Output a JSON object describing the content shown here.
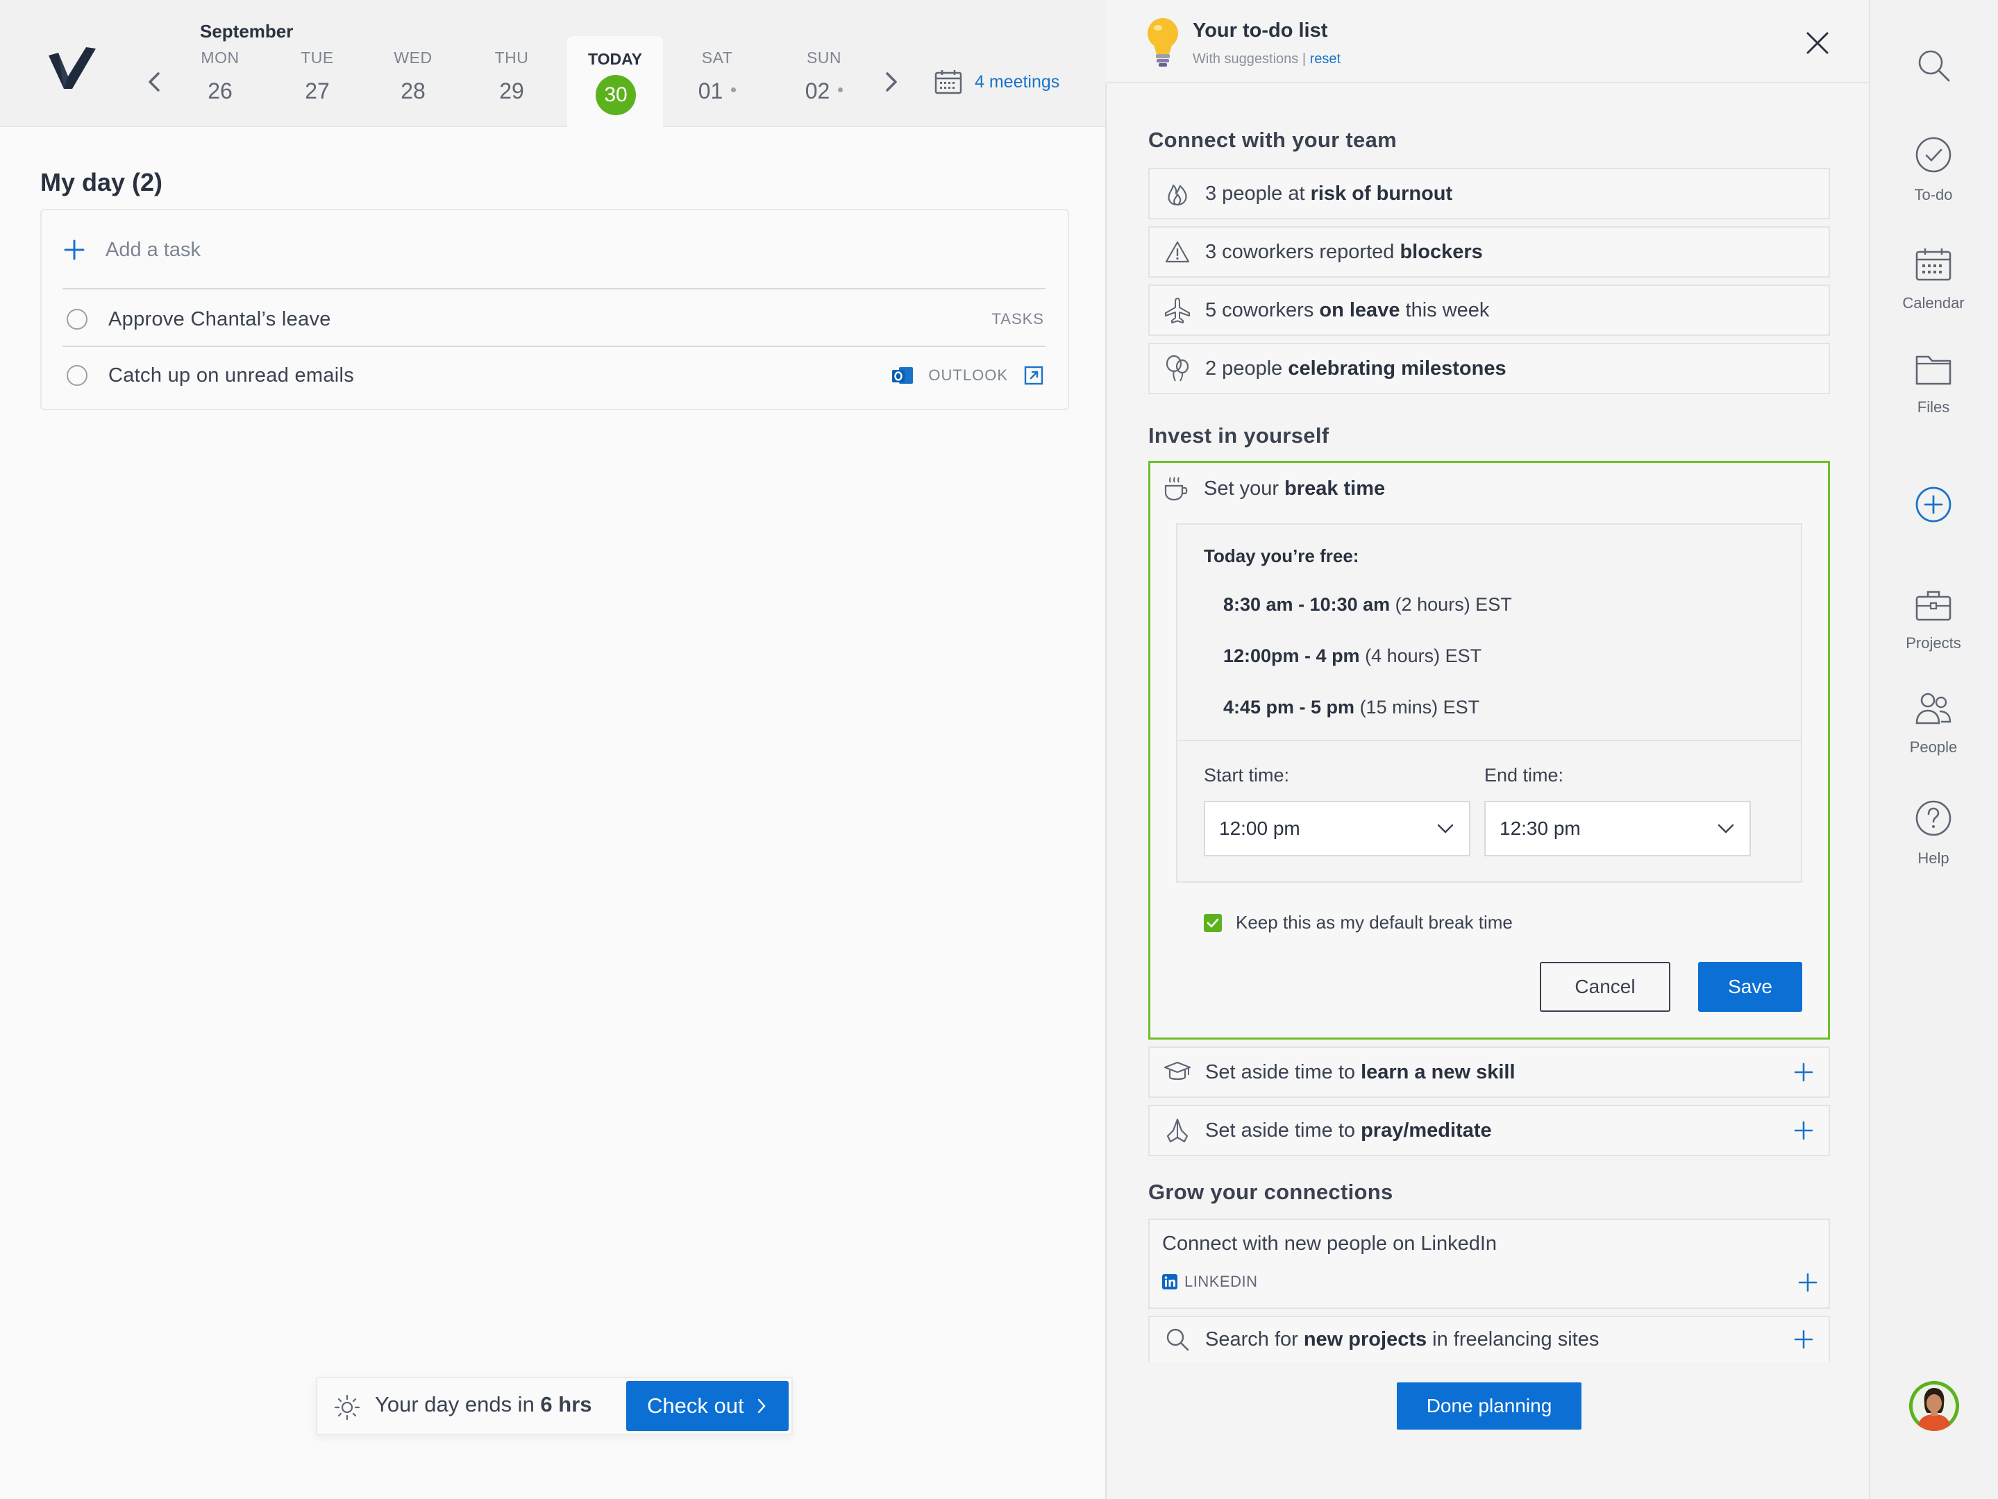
{
  "calendar": {
    "month": "September",
    "days": [
      {
        "name": "MON",
        "num": "26"
      },
      {
        "name": "TUE",
        "num": "27"
      },
      {
        "name": "WED",
        "num": "28"
      },
      {
        "name": "THU",
        "num": "29"
      },
      {
        "name": "TODAY",
        "num": "30"
      },
      {
        "name": "SAT",
        "num": "01"
      },
      {
        "name": "SUN",
        "num": "02"
      }
    ],
    "meetings": "4 meetings"
  },
  "myday": {
    "title": "My day (2)",
    "add_task": "Add a task",
    "tasks": [
      {
        "text": "Approve Chantal’s leave",
        "source": "TASKS"
      },
      {
        "text": "Catch up on unread emails",
        "source": "OUTLOOK"
      }
    ]
  },
  "daybar": {
    "text_prefix": "Your day ends in ",
    "hours": "6 hrs",
    "checkout": "Check out"
  },
  "todo": {
    "title": "Your to-do list",
    "subtitle": "With suggestions | ",
    "reset": "reset",
    "team_section": "Connect with your team",
    "team": [
      {
        "pre": "3 people at ",
        "bold": "risk of burnout",
        "post": "",
        "icon": "flame-icon"
      },
      {
        "pre": "3 coworkers reported ",
        "bold": "blockers",
        "post": "",
        "icon": "warning-icon"
      },
      {
        "pre": "5 coworkers ",
        "bold": "on leave",
        "post": " this week",
        "icon": "airplane-icon"
      },
      {
        "pre": "2 people ",
        "bold": "celebrating milestones",
        "post": "",
        "icon": "balloon-icon"
      }
    ],
    "invest_section": "Invest in yourself",
    "break": {
      "pre": "Set your ",
      "bold": "break time",
      "free_heading": "Today you’re free:",
      "slots": [
        {
          "bold": "8:30 am - 10:30 am",
          "rest": " (2 hours) EST"
        },
        {
          "bold": "12:00pm - 4 pm",
          "rest": " (4 hours) EST"
        },
        {
          "bold": "4:45 pm - 5 pm",
          "rest": " (15 mins) EST"
        }
      ],
      "start_label": "Start time:",
      "end_label": "End time:",
      "start_value": "12:00 pm",
      "end_value": "12:30 pm",
      "keep_default": "Keep this as my default break time",
      "cancel": "Cancel",
      "save": "Save"
    },
    "learn": {
      "pre": "Set aside time to ",
      "bold": "learn a new skill"
    },
    "pray": {
      "pre": "Set aside time to ",
      "bold": "pray/meditate"
    },
    "grow_section": "Grow your connections",
    "linkedin": {
      "title": "Connect with new people on LinkedIn",
      "badge": "LINKEDIN"
    },
    "search": {
      "pre": "Search for ",
      "bold": "new projects",
      "post": " in freelancing sites"
    },
    "done": "Done planning"
  },
  "nav": {
    "todo": "To-do",
    "calendar": "Calendar",
    "files": "Files",
    "projects": "Projects",
    "people": "People",
    "help": "Help"
  },
  "colors": {
    "accent_blue": "#0b6fd3",
    "accent_green": "#5cb21d"
  }
}
